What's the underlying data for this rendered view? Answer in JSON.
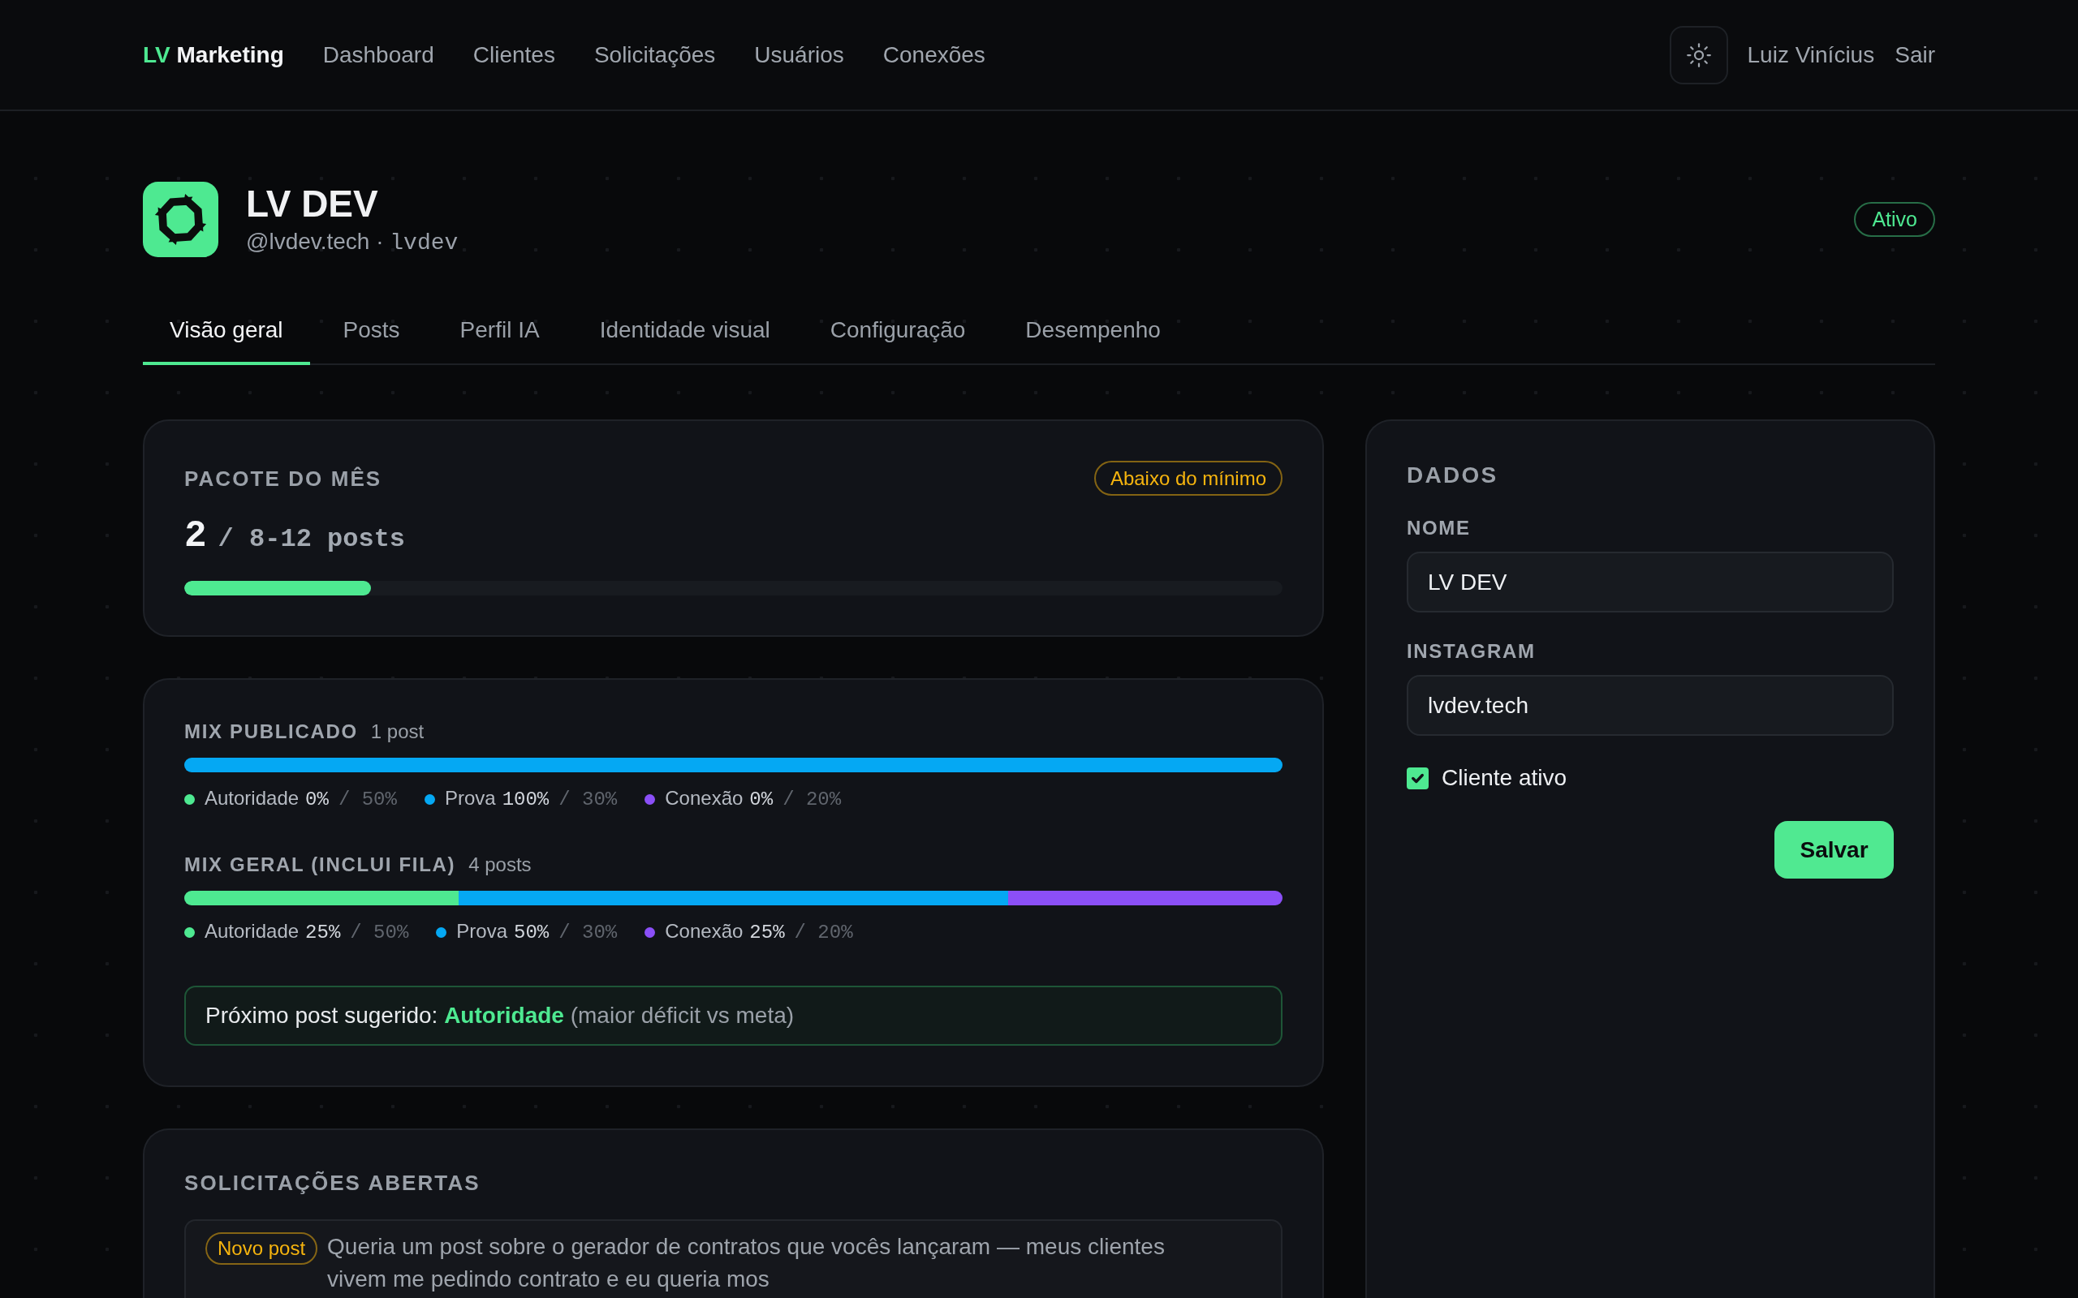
{
  "navbar": {
    "brand": {
      "accent": "LV",
      "name": "Marketing"
    },
    "links": [
      {
        "label": "Dashboard"
      },
      {
        "label": "Clientes"
      },
      {
        "label": "Solicitações"
      },
      {
        "label": "Usuários"
      },
      {
        "label": "Conexões"
      }
    ],
    "user": "Luiz Vinícius",
    "logout": "Sair"
  },
  "client": {
    "name": "LV DEV",
    "handle": "@lvdev.tech",
    "separator": "·",
    "slug": "lvdev",
    "status": {
      "label": "Ativo",
      "kind": "active"
    }
  },
  "tabs": [
    {
      "label": "Visão geral",
      "selected": true
    },
    {
      "label": "Posts",
      "selected": false
    },
    {
      "label": "Perfil IA",
      "selected": false
    },
    {
      "label": "Identidade visual",
      "selected": false
    },
    {
      "label": "Configuração",
      "selected": false
    },
    {
      "label": "Desempenho",
      "selected": false
    }
  ],
  "package": {
    "title": "PACOTE DO MÊS",
    "badge": {
      "label": "Abaixo do mínimo",
      "kind": "warning"
    },
    "count": "2",
    "target": "/ 8-12 posts",
    "level": 0.17
  },
  "mix": {
    "sections": [
      {
        "title": "MIX PUBLICADO",
        "count": "1 post",
        "items": [
          {
            "label": "Autoridade",
            "share": "0%",
            "target": "/ 50%",
            "color": "#4ee991"
          },
          {
            "label": "Prova",
            "share": "100%",
            "target": "/ 30%",
            "color": "#05a8f3"
          },
          {
            "label": "Conexão",
            "share": "0%",
            "target": "/ 20%",
            "color": "#8b4ff7"
          }
        ]
      },
      {
        "title": "MIX GERAL (INCLUI FILA)",
        "count": "4 posts",
        "items": [
          {
            "label": "Autoridade",
            "share": "25%",
            "target": "/ 50%",
            "color": "#4ee991"
          },
          {
            "label": "Prova",
            "share": "50%",
            "target": "/ 30%",
            "color": "#05a8f3"
          },
          {
            "label": "Conexão",
            "share": "25%",
            "target": "/ 20%",
            "color": "#8b4ff7"
          }
        ]
      }
    ],
    "suggestion": {
      "label": "Próximo post sugerido:",
      "category": "Autoridade",
      "note": "(maior déficit vs meta)"
    }
  },
  "requests": {
    "title": "SOLICITAÇÕES ABERTAS",
    "items": [
      {
        "tag": {
          "label": "Novo post",
          "kind": "warning"
        },
        "text": "Queria um post sobre o gerador de contratos que vocês lançaram — meus clientes vivem me pedindo contrato e eu queria mos"
      }
    ]
  },
  "form": {
    "title": "DADOS",
    "fields": [
      {
        "label": "NOME",
        "value": "LV DEV"
      },
      {
        "label": "INSTAGRAM",
        "value": "lvdev.tech"
      }
    ],
    "active": {
      "label": "Cliente ativo",
      "checked": true
    },
    "submit": "Salvar"
  }
}
